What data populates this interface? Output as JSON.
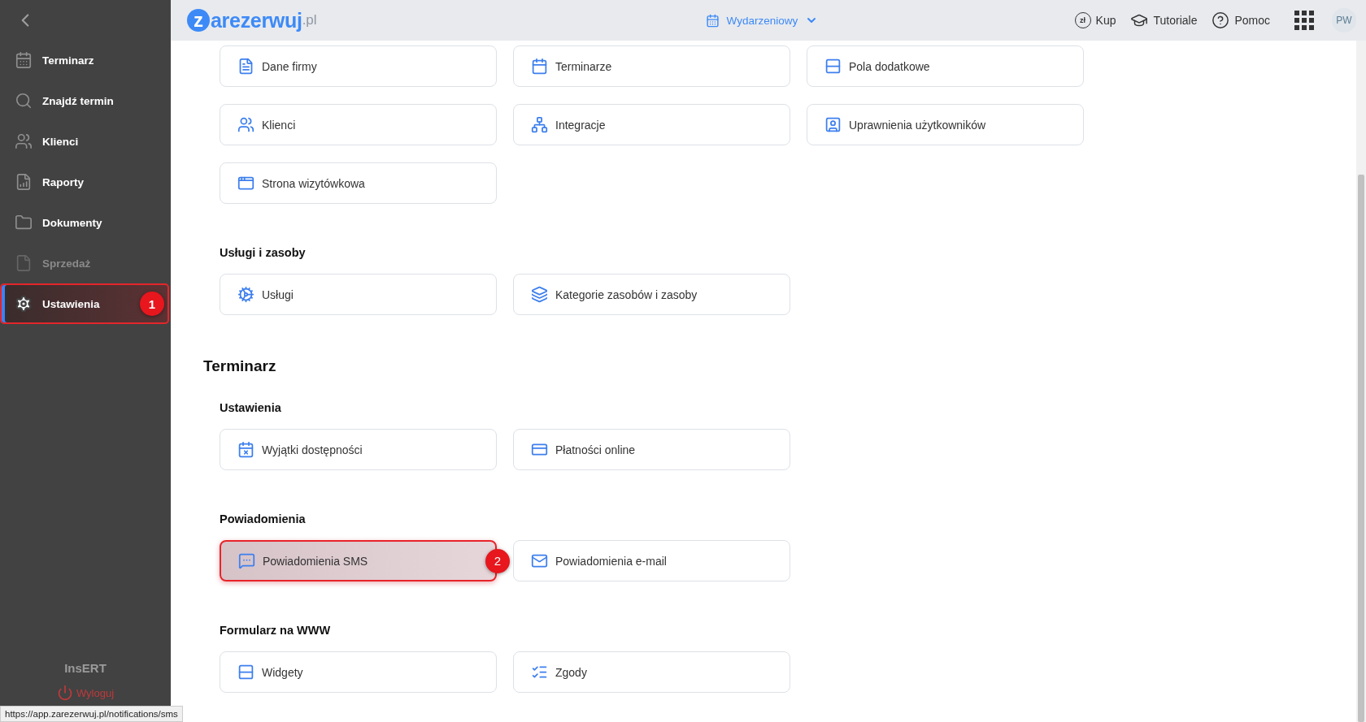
{
  "header": {
    "logo": {
      "mark": "z",
      "name": "arezerwuj",
      "domain": ".pl"
    },
    "mode_selector": {
      "label": "Wydarzeniowy"
    },
    "actions": [
      {
        "label": "Kup",
        "icon_text": "zł"
      },
      {
        "label": "Tutoriale"
      },
      {
        "label": "Pomoc"
      }
    ],
    "avatar": "PW"
  },
  "sidebar": {
    "items": [
      {
        "label": "Terminarz",
        "selected": false,
        "disabled": false,
        "highlighted": false
      },
      {
        "label": "Znajdź termin",
        "selected": false,
        "disabled": false,
        "highlighted": false
      },
      {
        "label": "Klienci",
        "selected": false,
        "disabled": false,
        "highlighted": false
      },
      {
        "label": "Raporty",
        "selected": false,
        "disabled": false,
        "highlighted": false
      },
      {
        "label": "Dokumenty",
        "selected": false,
        "disabled": false,
        "highlighted": false
      },
      {
        "label": "Sprzedaż",
        "selected": false,
        "disabled": true,
        "highlighted": false
      },
      {
        "label": "Ustawienia",
        "selected": true,
        "disabled": false,
        "highlighted": true,
        "badge": "1"
      }
    ],
    "brand": "InsERT",
    "logout": "Wyloguj"
  },
  "content": {
    "groups": [
      {
        "tiles": [
          {
            "label": "Dane firmy",
            "highlighted": false
          },
          {
            "label": "Terminarze",
            "highlighted": false
          },
          {
            "label": "Pola dodatkowe",
            "highlighted": false
          },
          {
            "label": "Klienci",
            "highlighted": false
          },
          {
            "label": "Integracje",
            "highlighted": false
          },
          {
            "label": "Uprawnienia użytkowników",
            "highlighted": false
          },
          {
            "label": "Strona wizytówkowa",
            "highlighted": false
          }
        ]
      },
      {
        "heading": "Usługi i zasoby",
        "tiles": [
          {
            "label": "Usługi",
            "highlighted": false
          },
          {
            "label": "Kategorie zasobów i zasoby",
            "highlighted": false
          }
        ]
      }
    ],
    "sections": [
      {
        "title": "Terminarz",
        "groups": [
          {
            "heading": "Ustawienia",
            "tiles": [
              {
                "label": "Wyjątki dostępności",
                "highlighted": false
              },
              {
                "label": "Płatności online",
                "highlighted": false
              }
            ]
          },
          {
            "heading": "Powiadomienia",
            "tiles": [
              {
                "label": "Powiadomienia SMS",
                "highlighted": true,
                "badge": "2"
              },
              {
                "label": "Powiadomienia e-mail",
                "highlighted": false
              }
            ]
          },
          {
            "heading": "Formularz na WWW",
            "tiles": [
              {
                "label": "Widgety",
                "highlighted": false
              },
              {
                "label": "Zgody",
                "highlighted": false
              }
            ]
          }
        ]
      }
    ]
  },
  "status_url": "https://app.zarezerwuj.pl/notifications/sms"
}
